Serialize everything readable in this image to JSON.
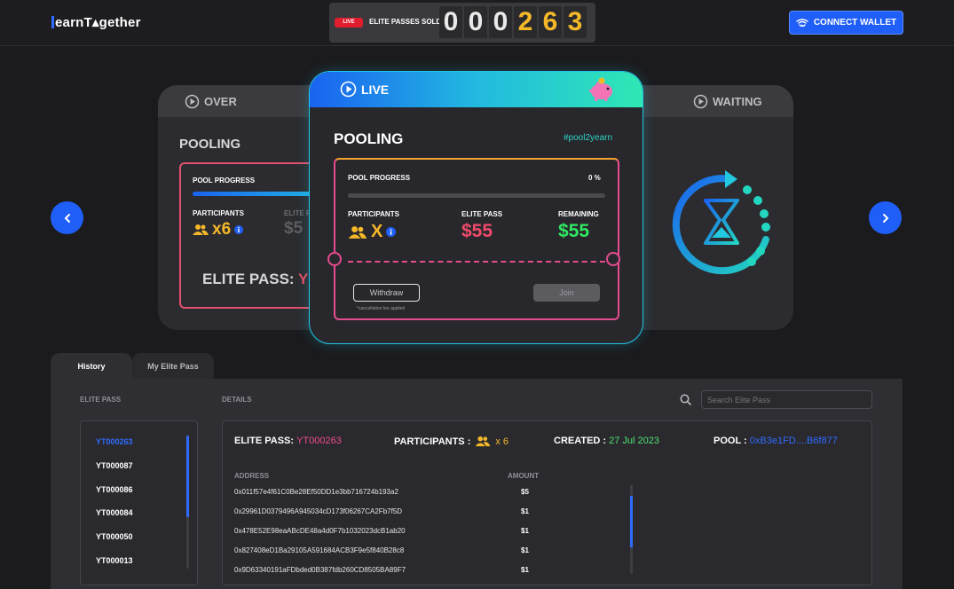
{
  "header": {
    "logo_text": "earnT▴gether",
    "live_badge": "LIVE",
    "sold_label": "ELITE PASSES SOLD",
    "sold_digits": [
      "0",
      "0",
      "0",
      "2",
      "6",
      "3"
    ],
    "connect_label": "CONNECT WALLET"
  },
  "carousel": {
    "left_card": {
      "status": "OVER",
      "pooling": "POOLING",
      "pool_progress": "POOL PROGRESS",
      "participants_label": "PARTICIPANTS",
      "participants_value": "x6",
      "elite_pass_label": "ELITE P",
      "elite_pass_value": "$5",
      "elite_pass_footer": "ELITE PASS:",
      "elite_pass_footer_value": "Y"
    },
    "main_card": {
      "status": "LIVE",
      "pooling": "POOLING",
      "hashtag": "#pool2yearn",
      "pool_progress_label": "POOL PROGRESS",
      "pool_progress_value": "0 %",
      "progress_fraction": 0,
      "participants_label": "PARTICIPANTS",
      "participants_value": "X",
      "elite_pass_label": "ELITE PASS",
      "elite_pass_value": "$55",
      "remaining_label": "REMAINING",
      "remaining_value": "$55",
      "withdraw_label": "Withdraw",
      "fee_note": "*cancellation fee applied",
      "join_label": "Join"
    },
    "right_card": {
      "status": "WAITING"
    }
  },
  "tabs": [
    {
      "label": "History",
      "active": true
    },
    {
      "label": "My Elite Pass",
      "active": false
    }
  ],
  "history": {
    "elite_pass_head": "ELITE PASS",
    "details_head": "DETAILS",
    "search_placeholder": "Search Elite Pass",
    "passes": [
      "YT000263",
      "YT000087",
      "YT000086",
      "YT000084",
      "YT000050",
      "YT000013"
    ],
    "details": {
      "elite_pass_label": "ELITE PASS:",
      "elite_pass_value": "YT000263",
      "participants_label": "PARTICIPANTS :",
      "participants_value": "x 6",
      "created_label": "CREATED :",
      "created_value": "27 Jul 2023",
      "pool_label": "POOL :",
      "pool_value": "0xB3e1FD....B6f877",
      "address_head": "ADDRESS",
      "amount_head": "AMOUNT",
      "rows": [
        {
          "address": "0x011f57e4f61C0Be28Ef50DD1e3bb716724b193a2",
          "amount": "$5"
        },
        {
          "address": "0x29961D0379496A945034cD173f06267CA2Fb7f5D",
          "amount": "$1"
        },
        {
          "address": "0x478E52E98eaABcDE48a4d0F7b1032023dcB1ab20",
          "amount": "$1"
        },
        {
          "address": "0x827408eD1Ba29105A591684ACB3F9e5f840B28c8",
          "amount": "$1"
        },
        {
          "address": "0x9D63340191aFDbded0B387fdb260CD8505BA89F7",
          "amount": "$1"
        }
      ]
    }
  },
  "colors": {
    "accent": "#1f5ef7",
    "gold": "#f5b829",
    "pink": "#e64b8f",
    "green": "#2fe862",
    "created_green": "#4ee06e"
  }
}
